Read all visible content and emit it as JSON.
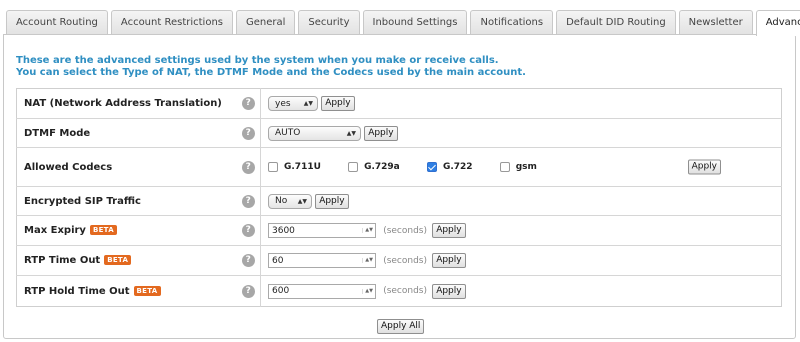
{
  "tabs": [
    {
      "label": "Account Routing",
      "active": false
    },
    {
      "label": "Account Restrictions",
      "active": false
    },
    {
      "label": "General",
      "active": false
    },
    {
      "label": "Security",
      "active": false
    },
    {
      "label": "Inbound Settings",
      "active": false
    },
    {
      "label": "Notifications",
      "active": false
    },
    {
      "label": "Default DID Routing",
      "active": false
    },
    {
      "label": "Newsletter",
      "active": false
    },
    {
      "label": "Advanced",
      "active": true
    }
  ],
  "intro": {
    "line1": "These are the advanced settings used by the system when you make or receive calls.",
    "line2": "You can select the Type of NAT, the DTMF Mode and the Codecs used by the main account."
  },
  "help_glyph": "?",
  "beta_label": "BETA",
  "apply_label": "Apply",
  "seconds_label": "(seconds)",
  "settings": {
    "nat": {
      "label": "NAT (Network Address Translation)",
      "value": "yes"
    },
    "dtmf": {
      "label": "DTMF Mode",
      "value": "AUTO"
    },
    "codecs": {
      "label": "Allowed Codecs",
      "items": [
        {
          "name": "G.711U",
          "checked": false
        },
        {
          "name": "G.729a",
          "checked": false
        },
        {
          "name": "G.722",
          "checked": true
        },
        {
          "name": "gsm",
          "checked": false
        }
      ]
    },
    "sip": {
      "label": "Encrypted SIP Traffic",
      "value": "No"
    },
    "max_expiry": {
      "label": "Max Expiry",
      "value": "3600"
    },
    "rtp_timeout": {
      "label": "RTP Time Out",
      "value": "60"
    },
    "rtp_hold": {
      "label": "RTP Hold Time Out",
      "value": "600"
    }
  },
  "apply_all_label": "Apply All",
  "colors": {
    "intro": "#2f8fc2",
    "beta": "#e3691f",
    "checkbox_checked": "#2f7fe3"
  }
}
